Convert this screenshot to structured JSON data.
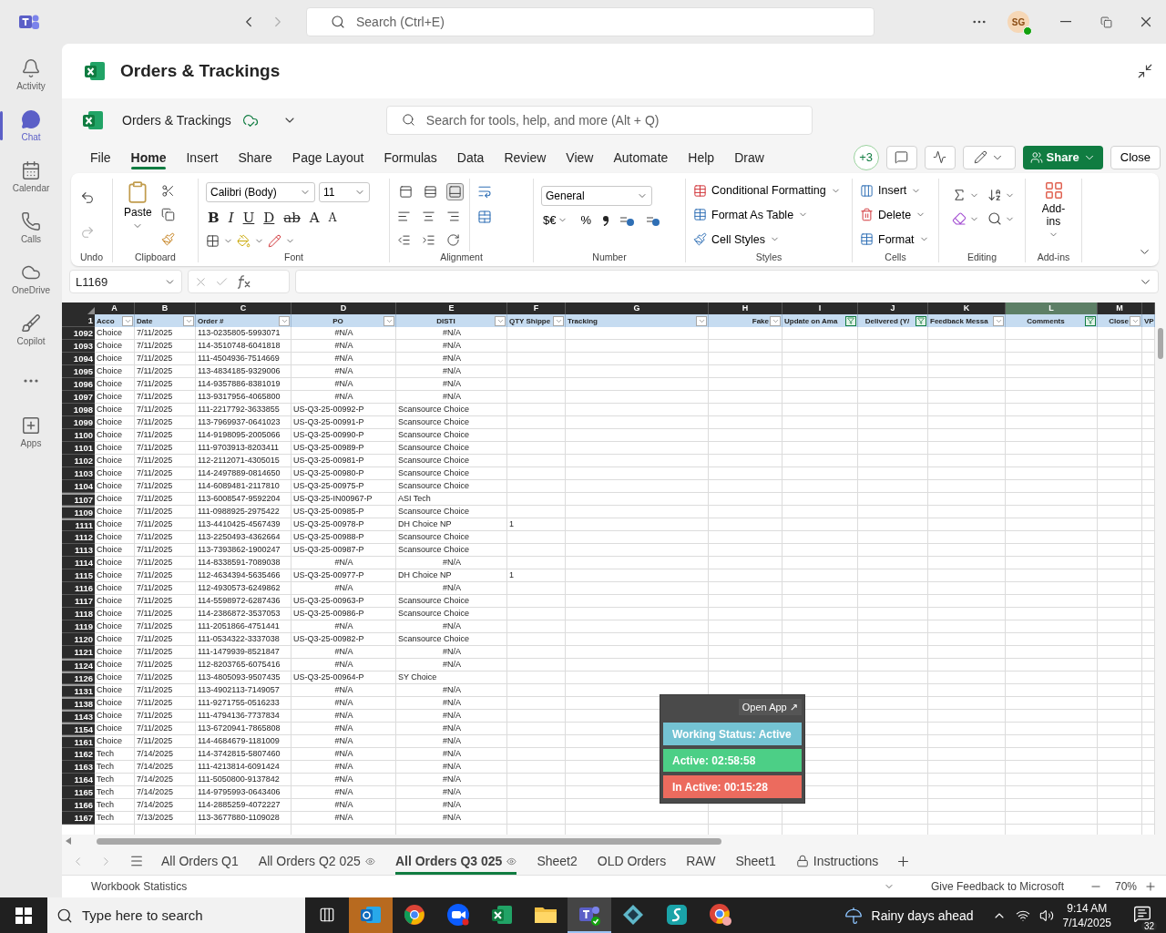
{
  "teams_bar": {
    "search_placeholder": "Search (Ctrl+E)",
    "avatar": "SG"
  },
  "rail": {
    "items": [
      {
        "label": "Activity",
        "selected": false
      },
      {
        "label": "Chat",
        "selected": true
      },
      {
        "label": "Calendar",
        "selected": false
      },
      {
        "label": "Calls",
        "selected": false
      },
      {
        "label": "OneDrive",
        "selected": false
      },
      {
        "label": "Copilot",
        "selected": false
      }
    ],
    "apps": {
      "label": "Apps",
      "selected": false
    }
  },
  "title": "Orders & Trackings",
  "excel_header": {
    "file_name": "Orders & Trackings",
    "search_placeholder": "Search for tools, help, and more (Alt + Q)"
  },
  "menu": {
    "tabs": [
      {
        "label": "File",
        "selected": false
      },
      {
        "label": "Home",
        "selected": true
      },
      {
        "label": "Insert",
        "selected": false
      },
      {
        "label": "Share",
        "selected": false
      },
      {
        "label": "Page Layout",
        "selected": false
      },
      {
        "label": "Formulas",
        "selected": false
      },
      {
        "label": "Data",
        "selected": false
      },
      {
        "label": "Review",
        "selected": false
      },
      {
        "label": "View",
        "selected": false
      },
      {
        "label": "Automate",
        "selected": false
      },
      {
        "label": "Help",
        "selected": false
      },
      {
        "label": "Draw",
        "selected": false
      }
    ],
    "collaborators": "+3",
    "share": "Share",
    "close": "Close"
  },
  "ribbon": {
    "groups": [
      "Undo",
      "Clipboard",
      "Font",
      "Alignment",
      "Number",
      "Styles",
      "Cells",
      "Editing",
      "Add-ins"
    ],
    "paste": "Paste",
    "font": "Calibri (Body)",
    "font_size": "11",
    "font_buttons": [
      "B",
      "I",
      "U",
      "D",
      "ab",
      "A",
      "A"
    ],
    "valign_buttons": [
      {
        "selected": false
      },
      {
        "selected": false
      },
      {
        "selected": true
      }
    ],
    "number_format": "General",
    "currency": "$€",
    "percent": "%",
    "styles": [
      "Conditional Formatting",
      "Format As Table",
      "Cell Styles"
    ],
    "cells": [
      "Insert",
      "Delete",
      "Format"
    ],
    "addins": "Add-ins"
  },
  "formula_bar": {
    "name_box": "L1169"
  },
  "grid": {
    "column_letters": [
      {
        "label": "A",
        "selected": false
      },
      {
        "label": "B",
        "selected": false
      },
      {
        "label": "C",
        "selected": false
      },
      {
        "label": "D",
        "selected": false
      },
      {
        "label": "E",
        "selected": false
      },
      {
        "label": "F",
        "selected": false
      },
      {
        "label": "G",
        "selected": false
      },
      {
        "label": "H",
        "selected": false
      },
      {
        "label": "I",
        "selected": false
      },
      {
        "label": "J",
        "selected": false
      },
      {
        "label": "K",
        "selected": false
      },
      {
        "label": "L",
        "selected": true
      },
      {
        "label": "M",
        "selected": false
      }
    ],
    "header_row": "1",
    "columns": [
      {
        "label": "Acco",
        "filtered": false
      },
      {
        "label": "Date",
        "filtered": false
      },
      {
        "label": "Order #",
        "filtered": false
      },
      {
        "label": "PO",
        "filtered": false
      },
      {
        "label": "DISTI",
        "filtered": false
      },
      {
        "label": "QTY Shippe",
        "filtered": false
      },
      {
        "label": "Tracking",
        "filtered": false
      },
      {
        "label": "Fake",
        "filtered": false
      },
      {
        "label": "Update on Ama",
        "filtered": true
      },
      {
        "label": "Delivered (Y/",
        "filtered": true
      },
      {
        "label": "Feedback Messa",
        "filtered": false
      },
      {
        "label": "Comments",
        "filtered": true
      },
      {
        "label": "Close",
        "filtered": false
      },
      {
        "label": "VP"
      }
    ],
    "rows": [
      {
        "row": "1092",
        "kind": "lookup_error",
        "hidden_above": false,
        "account": "Choice",
        "date": "7/11/2025",
        "order": "113-0235805-5993071",
        "po": "#N/A",
        "disti": "#N/A"
      },
      {
        "row": "1093",
        "kind": "lookup_error",
        "hidden_above": false,
        "account": "Choice",
        "date": "7/11/2025",
        "order": "114-3510748-6041818",
        "po": "#N/A",
        "disti": "#N/A"
      },
      {
        "row": "1094",
        "kind": "lookup_error",
        "hidden_above": false,
        "account": "Choice",
        "date": "7/11/2025",
        "order": "111-4504936-7514669",
        "po": "#N/A",
        "disti": "#N/A"
      },
      {
        "row": "1095",
        "kind": "lookup_error",
        "hidden_above": false,
        "account": "Choice",
        "date": "7/11/2025",
        "order": "113-4834185-9329006",
        "po": "#N/A",
        "disti": "#N/A"
      },
      {
        "row": "1096",
        "kind": "lookup_error",
        "hidden_above": false,
        "account": "Choice",
        "date": "7/11/2025",
        "order": "114-9357886-8381019",
        "po": "#N/A",
        "disti": "#N/A"
      },
      {
        "row": "1097",
        "kind": "lookup_error",
        "hidden_above": false,
        "account": "Choice",
        "date": "7/11/2025",
        "order": "113-9317956-4065800",
        "po": "#N/A",
        "disti": "#N/A"
      },
      {
        "row": "1098",
        "kind": "matched",
        "hidden_above": false,
        "account": "Choice",
        "date": "7/11/2025",
        "order": "111-2217792-3633855",
        "po": "US-Q3-25-00992-P",
        "disti": "Scansource Choice"
      },
      {
        "row": "1099",
        "kind": "matched",
        "hidden_above": false,
        "account": "Choice",
        "date": "7/11/2025",
        "order": "113-7969937-0641023",
        "po": "US-Q3-25-00991-P",
        "disti": "Scansource Choice"
      },
      {
        "row": "1100",
        "kind": "matched",
        "hidden_above": false,
        "account": "Choice",
        "date": "7/11/2025",
        "order": "114-9198095-2005066",
        "po": "US-Q3-25-00990-P",
        "disti": "Scansource Choice"
      },
      {
        "row": "1101",
        "kind": "matched",
        "hidden_above": false,
        "account": "Choice",
        "date": "7/11/2025",
        "order": "111-9703913-8203411",
        "po": "US-Q3-25-00989-P",
        "disti": "Scansource Choice"
      },
      {
        "row": "1102",
        "kind": "matched",
        "hidden_above": false,
        "account": "Choice",
        "date": "7/11/2025",
        "order": "112-2112071-4305015",
        "po": "US-Q3-25-00981-P",
        "disti": "Scansource Choice"
      },
      {
        "row": "1103",
        "kind": "matched",
        "hidden_above": false,
        "account": "Choice",
        "date": "7/11/2025",
        "order": "114-2497889-0814650",
        "po": "US-Q3-25-00980-P",
        "disti": "Scansource Choice"
      },
      {
        "row": "1104",
        "kind": "matched",
        "hidden_above": false,
        "account": "Choice",
        "date": "7/11/2025",
        "order": "114-6089481-2117810",
        "po": "US-Q3-25-00975-P",
        "disti": "Scansource Choice"
      },
      {
        "row": "1107",
        "kind": "matched",
        "hidden_above": true,
        "account": "Choice",
        "date": "7/11/2025",
        "order": "113-6008547-9592204",
        "po": "US-Q3-25-IN00967-P",
        "disti": "ASI Tech"
      },
      {
        "row": "1109",
        "kind": "matched",
        "hidden_above": true,
        "account": "Choice",
        "date": "7/11/2025",
        "order": "111-0988925-2975422",
        "po": "US-Q3-25-00985-P",
        "disti": "Scansource Choice"
      },
      {
        "row": "1111",
        "kind": "matched",
        "hidden_above": true,
        "account": "Choice",
        "date": "7/11/2025",
        "order": "113-4410425-4567439",
        "po": "US-Q3-25-00978-P",
        "disti": "DH Choice NP",
        "qty": "1"
      },
      {
        "row": "1112",
        "kind": "matched",
        "hidden_above": false,
        "account": "Choice",
        "date": "7/11/2025",
        "order": "113-2250493-4362664",
        "po": "US-Q3-25-00988-P",
        "disti": "Scansource Choice"
      },
      {
        "row": "1113",
        "kind": "matched",
        "hidden_above": false,
        "account": "Choice",
        "date": "7/11/2025",
        "order": "113-7393862-1900247",
        "po": "US-Q3-25-00987-P",
        "disti": "Scansource Choice"
      },
      {
        "row": "1114",
        "kind": "lookup_error",
        "hidden_above": false,
        "account": "Choice",
        "date": "7/11/2025",
        "order": "114-8338591-7089038",
        "po": "#N/A",
        "disti": "#N/A"
      },
      {
        "row": "1115",
        "kind": "matched",
        "hidden_above": false,
        "account": "Choice",
        "date": "7/11/2025",
        "order": "112-4634394-5635466",
        "po": "US-Q3-25-00977-P",
        "disti": "DH Choice NP",
        "qty": "1"
      },
      {
        "row": "1116",
        "kind": "lookup_error",
        "hidden_above": false,
        "account": "Choice",
        "date": "7/11/2025",
        "order": "112-4930573-6249862",
        "po": "#N/A",
        "disti": "#N/A"
      },
      {
        "row": "1117",
        "kind": "matched",
        "hidden_above": false,
        "account": "Choice",
        "date": "7/11/2025",
        "order": "114-5598972-6287436",
        "po": "US-Q3-25-00963-P",
        "disti": "Scansource Choice"
      },
      {
        "row": "1118",
        "kind": "matched",
        "hidden_above": false,
        "account": "Choice",
        "date": "7/11/2025",
        "order": "114-2386872-3537053",
        "po": "US-Q3-25-00986-P",
        "disti": "Scansource Choice"
      },
      {
        "row": "1119",
        "kind": "lookup_error",
        "hidden_above": false,
        "account": "Choice",
        "date": "7/11/2025",
        "order": "111-2051866-4751441",
        "po": "#N/A",
        "disti": "#N/A"
      },
      {
        "row": "1120",
        "kind": "matched",
        "hidden_above": false,
        "account": "Choice",
        "date": "7/11/2025",
        "order": "111-0534322-3337038",
        "po": "US-Q3-25-00982-P",
        "disti": "Scansource Choice"
      },
      {
        "row": "1121",
        "kind": "lookup_error",
        "hidden_above": false,
        "account": "Choice",
        "date": "7/11/2025",
        "order": "111-1479939-8521847",
        "po": "#N/A",
        "disti": "#N/A"
      },
      {
        "row": "1124",
        "kind": "lookup_error",
        "hidden_above": true,
        "account": "Choice",
        "date": "7/11/2025",
        "order": "112-8203765-6075416",
        "po": "#N/A",
        "disti": "#N/A"
      },
      {
        "row": "1126",
        "kind": "matched",
        "hidden_above": true,
        "account": "Choice",
        "date": "7/11/2025",
        "order": "113-4805093-9507435",
        "po": "US-Q3-25-00964-P",
        "disti": "SY Choice"
      },
      {
        "row": "1131",
        "kind": "lookup_error",
        "hidden_above": true,
        "account": "Choice",
        "date": "7/11/2025",
        "order": "113-4902113-7149057",
        "po": "#N/A",
        "disti": "#N/A"
      },
      {
        "row": "1138",
        "kind": "lookup_error",
        "hidden_above": true,
        "account": "Choice",
        "date": "7/11/2025",
        "order": "111-9271755-0516233",
        "po": "#N/A",
        "disti": "#N/A"
      },
      {
        "row": "1143",
        "kind": "lookup_error",
        "hidden_above": true,
        "account": "Choice",
        "date": "7/11/2025",
        "order": "111-4794136-7737834",
        "po": "#N/A",
        "disti": "#N/A"
      },
      {
        "row": "1154",
        "kind": "lookup_error",
        "hidden_above": true,
        "account": "Choice",
        "date": "7/11/2025",
        "order": "113-6720941-7865808",
        "po": "#N/A",
        "disti": "#N/A"
      },
      {
        "row": "1161",
        "kind": "lookup_error",
        "hidden_above": true,
        "account": "Choice",
        "date": "7/11/2025",
        "order": "114-4684679-1181009",
        "po": "#N/A",
        "disti": "#N/A"
      },
      {
        "row": "1162",
        "kind": "lookup_error",
        "hidden_above": false,
        "account": "Tech",
        "date": "7/14/2025",
        "order": "114-3742815-5807460",
        "po": "#N/A",
        "disti": "#N/A"
      },
      {
        "row": "1163",
        "kind": "lookup_error",
        "hidden_above": false,
        "account": "Tech",
        "date": "7/14/2025",
        "order": "111-4213814-6091424",
        "po": "#N/A",
        "disti": "#N/A"
      },
      {
        "row": "1164",
        "kind": "lookup_error",
        "hidden_above": false,
        "account": "Tech",
        "date": "7/14/2025",
        "order": "111-5050800-9137842",
        "po": "#N/A",
        "disti": "#N/A"
      },
      {
        "row": "1165",
        "kind": "lookup_error",
        "hidden_above": false,
        "account": "Tech",
        "date": "7/14/2025",
        "order": "114-9795993-0643406",
        "po": "#N/A",
        "disti": "#N/A"
      },
      {
        "row": "1166",
        "kind": "lookup_error",
        "hidden_above": false,
        "account": "Tech",
        "date": "7/14/2025",
        "order": "114-2885259-4072227",
        "po": "#N/A",
        "disti": "#N/A"
      },
      {
        "row": "1167",
        "kind": "lookup_error",
        "hidden_above": false,
        "account": "Tech",
        "date": "7/13/2025",
        "order": "113-3677880-1109028",
        "po": "#N/A",
        "disti": "#N/A"
      }
    ]
  },
  "status_widget": {
    "open_app": "Open App ↗",
    "lines": [
      {
        "text": "Working Status: Active",
        "color": "#74c3d3"
      },
      {
        "text": "Active: 02:58:58",
        "color": "#4ccf86"
      },
      {
        "text": "In Active: 00:15:28",
        "color": "#ec6b5e"
      }
    ]
  },
  "sheet_tabs": [
    {
      "label": "All Orders Q1",
      "selected": false,
      "kind": "plain"
    },
    {
      "label": "All Orders Q2 025",
      "selected": false,
      "kind": "watched"
    },
    {
      "label": "All Orders Q3 025",
      "selected": true,
      "kind": "watched"
    },
    {
      "label": "Sheet2",
      "selected": false,
      "kind": "plain"
    },
    {
      "label": "OLD Orders",
      "selected": false,
      "kind": "plain"
    },
    {
      "label": "RAW",
      "selected": false,
      "kind": "plain"
    },
    {
      "label": "Sheet1",
      "selected": false,
      "kind": "plain"
    },
    {
      "label": "Instructions",
      "selected": false,
      "kind": "locked"
    }
  ],
  "status_bar": {
    "left": "Workbook Statistics",
    "feedback": "Give Feedback to Microsoft",
    "zoom": "70%"
  },
  "taskbar": {
    "search_placeholder": "Type here to search",
    "apps": [
      {
        "kind": "mail",
        "selected": false,
        "alert": true
      },
      {
        "kind": "browser",
        "selected": false,
        "alert": false
      },
      {
        "kind": "video",
        "selected": false,
        "alert": false
      },
      {
        "kind": "spreadsheet",
        "selected": false,
        "alert": false
      },
      {
        "kind": "folder",
        "selected": false,
        "alert": false
      },
      {
        "kind": "chat",
        "selected": true,
        "alert": false
      },
      {
        "kind": "diamond",
        "selected": false,
        "alert": false
      },
      {
        "kind": "script",
        "selected": false,
        "alert": false
      },
      {
        "kind": "browser_profile",
        "selected": false,
        "alert": false
      }
    ],
    "weather": "Rainy days ahead",
    "time": "9:14 AM",
    "date": "7/14/2025",
    "notifications": "32"
  }
}
